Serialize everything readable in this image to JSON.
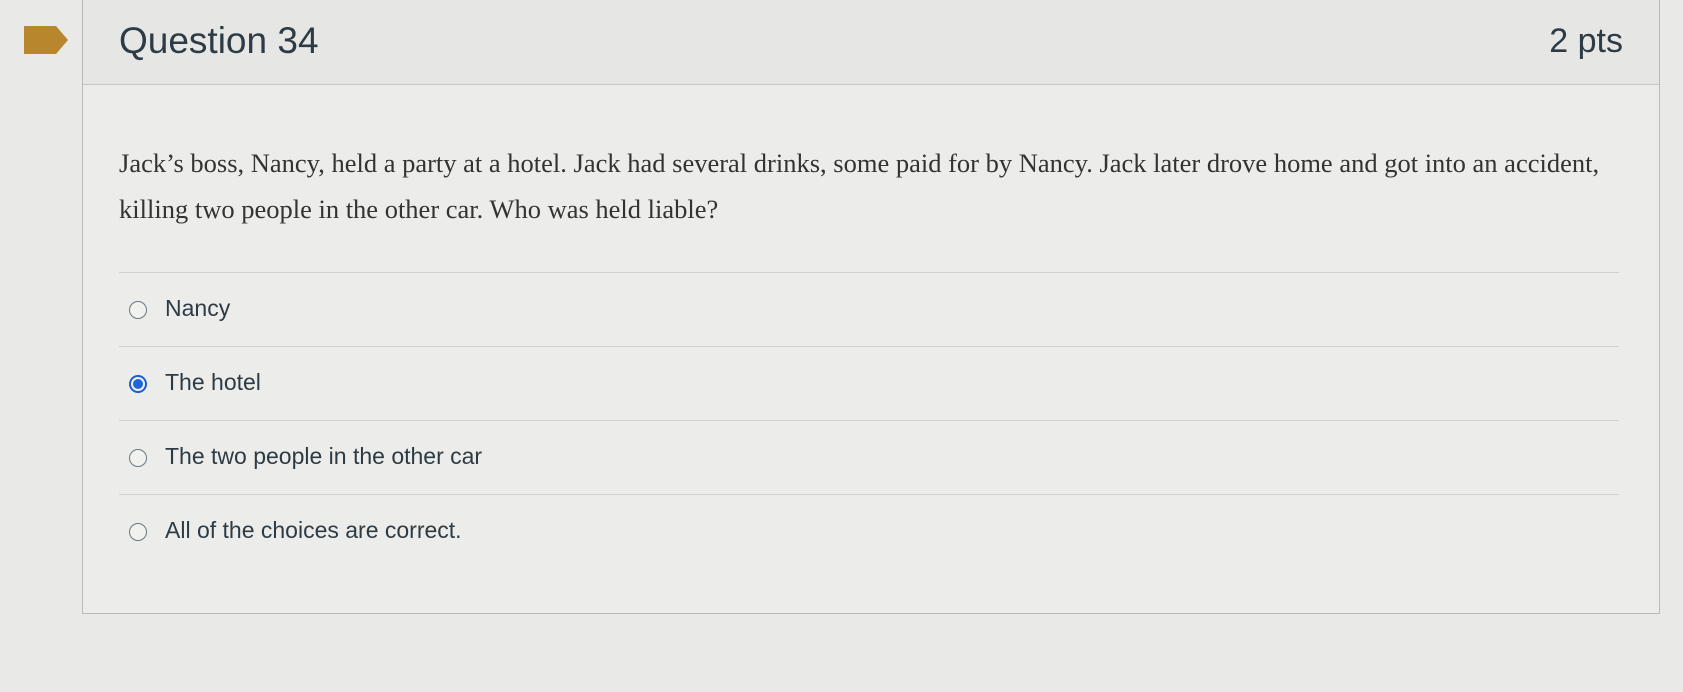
{
  "question": {
    "title": "Question 34",
    "points": "2 pts",
    "text": "Jack’s boss, Nancy, held a party at a hotel. Jack had several drinks, some paid for by Nancy. Jack later drove home and got into an accident, killing two people in the other car. Who was held liable?",
    "flag_icon": "bookmark-flag-icon",
    "flag_color": "#b8862d"
  },
  "answers": [
    {
      "label": "Nancy",
      "selected": false
    },
    {
      "label": "The hotel",
      "selected": true
    },
    {
      "label": "The two people in the other car",
      "selected": false
    },
    {
      "label": "All of the choices are correct.",
      "selected": false
    }
  ],
  "colors": {
    "selected_radio": "#1f66d6",
    "text": "#2d3b45"
  }
}
